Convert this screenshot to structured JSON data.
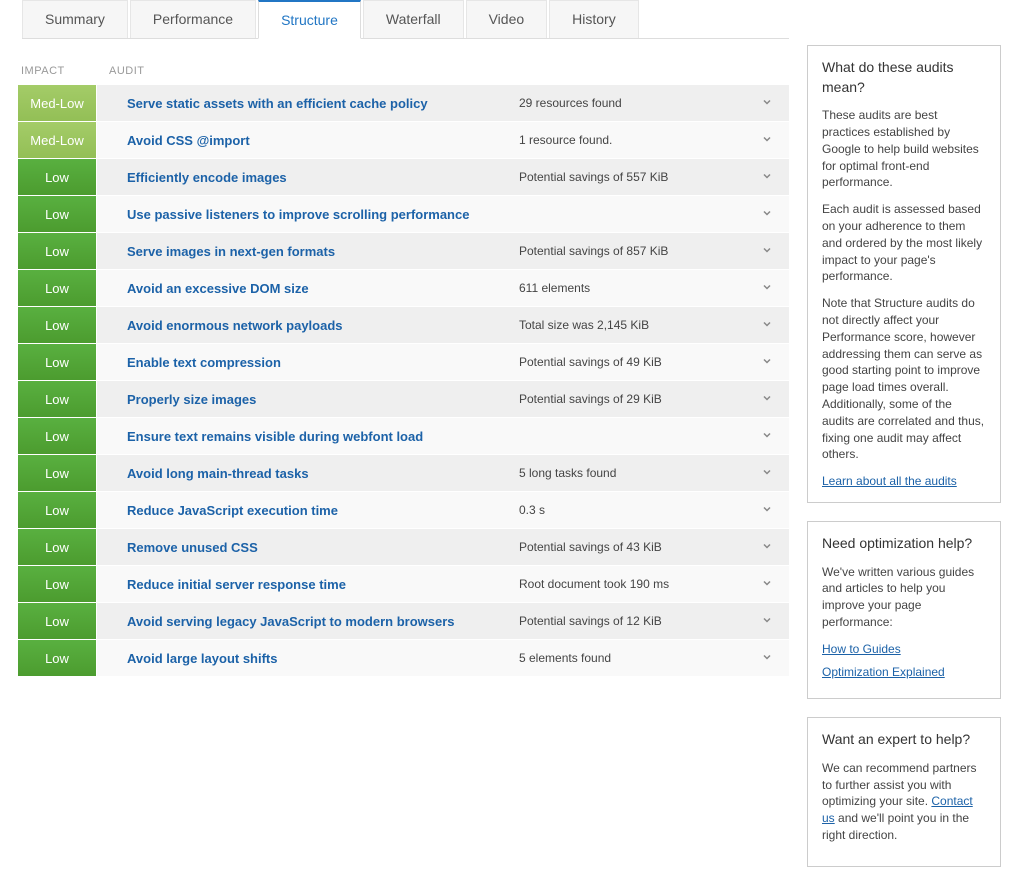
{
  "tabs": [
    {
      "label": "Summary",
      "active": false
    },
    {
      "label": "Performance",
      "active": false
    },
    {
      "label": "Structure",
      "active": true
    },
    {
      "label": "Waterfall",
      "active": false
    },
    {
      "label": "Video",
      "active": false
    },
    {
      "label": "History",
      "active": false
    }
  ],
  "headers": {
    "impact": "IMPACT",
    "audit": "AUDIT"
  },
  "audits": [
    {
      "impact": "Med-Low",
      "impactClass": "medlow",
      "title": "Serve static assets with an efficient cache policy",
      "detail": "29 resources found"
    },
    {
      "impact": "Med-Low",
      "impactClass": "medlow",
      "title": "Avoid CSS @import",
      "detail": "1 resource found."
    },
    {
      "impact": "Low",
      "impactClass": "low",
      "title": "Efficiently encode images",
      "detail": "Potential savings of 557 KiB"
    },
    {
      "impact": "Low",
      "impactClass": "low",
      "title": "Use passive listeners to improve scrolling performance",
      "detail": ""
    },
    {
      "impact": "Low",
      "impactClass": "low",
      "title": "Serve images in next-gen formats",
      "detail": "Potential savings of 857 KiB"
    },
    {
      "impact": "Low",
      "impactClass": "low",
      "title": "Avoid an excessive DOM size",
      "detail": "611 elements"
    },
    {
      "impact": "Low",
      "impactClass": "low",
      "title": "Avoid enormous network payloads",
      "detail": "Total size was 2,145 KiB"
    },
    {
      "impact": "Low",
      "impactClass": "low",
      "title": "Enable text compression",
      "detail": "Potential savings of 49 KiB"
    },
    {
      "impact": "Low",
      "impactClass": "low",
      "title": "Properly size images",
      "detail": "Potential savings of 29 KiB"
    },
    {
      "impact": "Low",
      "impactClass": "low",
      "title": "Ensure text remains visible during webfont load",
      "detail": ""
    },
    {
      "impact": "Low",
      "impactClass": "low",
      "title": "Avoid long main-thread tasks",
      "detail": "5 long tasks found"
    },
    {
      "impact": "Low",
      "impactClass": "low",
      "title": "Reduce JavaScript execution time",
      "detail": "0.3 s"
    },
    {
      "impact": "Low",
      "impactClass": "low",
      "title": "Remove unused CSS",
      "detail": "Potential savings of 43 KiB"
    },
    {
      "impact": "Low",
      "impactClass": "low",
      "title": "Reduce initial server response time",
      "detail": "Root document took 190 ms"
    },
    {
      "impact": "Low",
      "impactClass": "low",
      "title": "Avoid serving legacy JavaScript to modern browsers",
      "detail": "Potential savings of 12 KiB"
    },
    {
      "impact": "Low",
      "impactClass": "low",
      "title": "Avoid large layout shifts",
      "detail": "5 elements found"
    }
  ],
  "sidebar": {
    "box1": {
      "title": "What do these audits mean?",
      "p1": "These audits are best practices established by Google to help build websites for optimal front-end performance.",
      "p2": "Each audit is assessed based on your adherence to them and ordered by the most likely impact to your page's performance.",
      "p3": "Note that Structure audits do not directly affect your Performance score, however addressing them can serve as good starting point to improve page load times overall. Additionally, some of the audits are correlated and thus, fixing one audit may affect others.",
      "link": "Learn about all the audits"
    },
    "box2": {
      "title": "Need optimization help?",
      "p1": "We've written various guides and articles to help you improve your page performance:",
      "link1": "How to Guides",
      "link2": "Optimization Explained"
    },
    "box3": {
      "title": "Want an expert to help?",
      "p1_a": "We can recommend partners to further assist you with optimizing your site. ",
      "p1_link": "Contact us",
      "p1_b": " and we'll point you in the right direction."
    }
  }
}
